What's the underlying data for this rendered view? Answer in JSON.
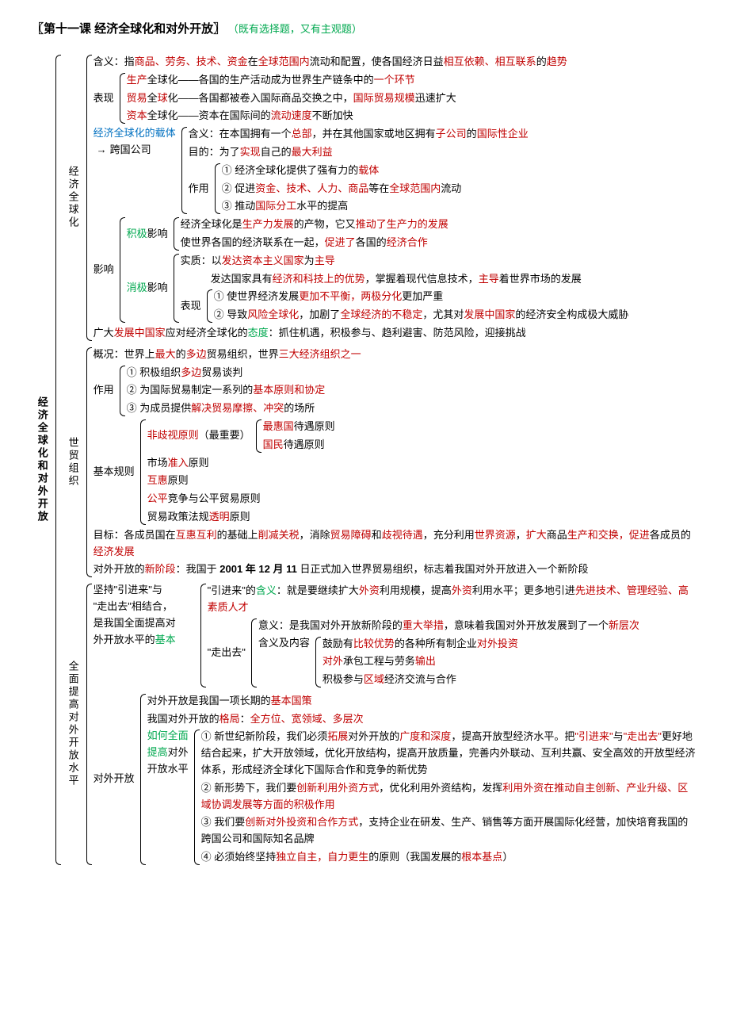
{
  "title": "〖第十一课 经济全球化和对外开放〗",
  "subtitle_open": "（",
  "subtitle_text": "既有选择题，又有主观题",
  "subtitle_close": "）",
  "root": "经济全球化和对外开放",
  "s1": {
    "label": "经济全球化",
    "l1a": "含义：指",
    "l1b": "商品、劳务、技术、资金",
    "l1c": "在",
    "l1d": "全球范围内",
    "l1e": "流动和配置，使各国经济日益",
    "l1f": "相互依赖、相互联系",
    "l1g": "的",
    "l1h": "趋势",
    "bx_label": "表现",
    "bx1a": "生产",
    "bx1b": "全球化——各国的生产活动成为世界生产链条中的",
    "bx1c": "一个环节",
    "bx2a": "贸易",
    "bx2b": "全",
    "bx2c": "球",
    "bx2d": "化——各国都被卷入国际商品交换之中，",
    "bx2e": "国际贸易规模",
    "bx2f": "迅速扩大",
    "bx3a": "资本",
    "bx3b": "全球化——资本在国际间的",
    "bx3c": "流动速度",
    "bx3d": "不断加快",
    "carrier_a": "经济全球化的载体",
    "carrier_arrow": "→",
    "carrier_b": "跨国公司",
    "c1a": "含义：在本国拥有一个",
    "c1b": "总部",
    "c1c": "，并在其他国家或地区拥有",
    "c1d": "子公司",
    "c1e": "的",
    "c1f": "国际性企业",
    "c2a": "目的：为了",
    "c2b": "实现",
    "c2c": "自己的",
    "c2d": "最大利益",
    "c_role": "作用",
    "cr1a": "① 经济全球化提供了强有力的",
    "cr1b": "载体",
    "cr2a": "② 促进",
    "cr2b": "资金、技术、人力、商品",
    "cr2c": "等在",
    "cr2d": "全球范围内",
    "cr2e": "流动",
    "cr3a": "③ 推动",
    "cr3b": "国际分工",
    "cr3c": "水平的提高",
    "inf_label": "影响",
    "pos_label": "积极",
    "pos_label2": "影响",
    "p1a": "经济全球化是",
    "p1b": "生产力发展",
    "p1c": "的产物，它又",
    "p1d": "推动了生产力的发展",
    "p2a": "使世界各国的经济联系在一起，",
    "p2b": "促进了",
    "p2c": "各国的",
    "p2d": "经济合作",
    "neg_label": "消极",
    "neg_label2": "影响",
    "n1a": "实质：以",
    "n1b": "发达资本主义国家",
    "n1c": "为",
    "n1d": "主导",
    "n2a": "发达国家具有",
    "n2b": "经济和科技上的优势",
    "n2c": "，掌握着现代信息技术，",
    "n2d": "主导",
    "n2e": "着世界市场的发展",
    "n_bx": "表现",
    "nb1a": "① 使世界经济发展",
    "nb1b": "更加不平衡，两极分化",
    "nb1c": "更加严重",
    "nb2a": "② 导致",
    "nb2b": "风险全球化",
    "nb2c": "，加剧了",
    "nb2d": "全球经济的不稳定",
    "nb2e": "，尤其对",
    "nb2f": "发展中国家",
    "nb2g": "的经济安全构成极大威胁",
    "att1": "广大",
    "att2": "发展中国家",
    "att3": "应对经济全球化的",
    "att4": "态度",
    "att5": "：抓住机遇，积极参与、趋利避害、防范风险，迎接挑战"
  },
  "s2": {
    "label": "世贸组织",
    "ov1": "概况：世界上",
    "ov2": "最大",
    "ov3": "的",
    "ov4": "多边",
    "ov5": "贸易组织，世界",
    "ov6": "三大经济组织之一",
    "role": "作用",
    "r1a": "① 积极组织",
    "r1b": "多边",
    "r1c": "贸易谈判",
    "r2a": "② 为国际贸易制定一系列的",
    "r2b": "基本原则和协定",
    "r3a": "③ 为成员提供",
    "r3b": "解决贸易摩擦、冲突",
    "r3c": "的场所",
    "rules": "基本规则",
    "ru1a": "非歧视原则",
    "ru1b": "（最重要）",
    "ru1c1": "最惠国",
    "ru1c2": "待遇原则",
    "ru1d1": "国民",
    "ru1d2": "待遇原则",
    "ru2a": "市场",
    "ru2b": "准入",
    "ru2c": "原则",
    "ru3a": "互惠",
    "ru3b": "原则",
    "ru4a": "公平",
    "ru4b": "竞争与公平贸易原则",
    "ru5a": "贸易政策法规",
    "ru5b": "透明",
    "ru5c": "原则",
    "goal1": "目标：各成员国在",
    "goal2": "互惠互利",
    "goal3": "的基础上",
    "goal4": "削减关税",
    "goal5": "，消除",
    "goal6": "贸易障碍",
    "goal7": "和",
    "goal8": "歧视待遇",
    "goal9": "，充分利用",
    "goal10": "世界资源",
    "goal11": "，",
    "goal12": "扩大",
    "goal13": "商品",
    "goal14": "生产和交换，促进",
    "goal15": "各成员的",
    "goal16": "经济发展",
    "new1": "对外开放的",
    "new2": "新阶段",
    "new3": "：我国于 ",
    "new4": "2001 年 12 月 11",
    "new5": " 日正式加入世界贸易组织，标志着我国对外开放进入一个新阶段"
  },
  "s3": {
    "label": "全面提高对外开放水平",
    "comb_l1": "坚持\"引进来\"与",
    "comb_l2": "\"走出去\"相结合，",
    "comb_l3": "是我国全面提高对",
    "comb_l4": "外开放水平的",
    "comb_l4b": "基本",
    "in1": "\"引进来\"的",
    "in2": "含义",
    "in3": "：就是要继续扩大",
    "in4": "外资",
    "in5": "利用规模，提高",
    "in6": "外资",
    "in7": "利用水平；更多地引进",
    "in8": "先进技术、管理经验、高素质人才",
    "out_label": "\"走出去\"",
    "om1": "意义：是我国对外开放新阶段的",
    "om2": "重大举措",
    "om3": "，意味着我国对外开放发展到了一个",
    "om4": "新层次",
    "oc_label": "含义及内容",
    "oc1a": "鼓励有",
    "oc1b": "比较优势",
    "oc1c": "的各种所有制企业",
    "oc1d": "对外投资",
    "oc2a": "对外",
    "oc2b": "承包工程与劳务",
    "oc2c": "输出",
    "oc3a": "积极参与",
    "oc3b": "区域",
    "oc3c": "经济交流与合作",
    "open_label": "对外开放",
    "op1a": "对外开放是我国一项长期的",
    "op1b": "基本国策",
    "op2a": "我国对外开放的",
    "op2b": "格局",
    "op2c": "：",
    "op2d": "全方位、宽领域、多层次",
    "how_l1": "如何全面",
    "how_l2": "提高",
    "how_l2b": "对外",
    "how_l3": "开放水平",
    "h1a": "① 新世纪新阶段，我们必须",
    "h1b": "拓展",
    "h1c": "对外开放的",
    "h1d": "广度和深度",
    "h1e": "，提高开放型经济水平。把",
    "h1f": "\"引进来\"",
    "h1g": "与",
    "h1h": "\"走出去\"",
    "h1i": "更好地结合起来，扩大开放领域，优化开放结构，提高开放质量，完善内外联动、互利共赢、安全高效的开放型经济体系，形成经济全球化下国际合作和竞争的新优势",
    "h2a": "② 新形势下，我们要",
    "h2b": "创新利用外资方式",
    "h2c": "，优化利用外资结构，发挥",
    "h2d2": "利用外资在推动自主创新、产业升级、区域协调发展等方面的积极作用",
    "h3a": "③ 我们要",
    "h3b": "创新对外投资和合作方式",
    "h3c": "，支持企业在研发、生产、销售等方面开展国际化经营，加快培育我国的跨国公司和国际知名品牌",
    "h4a": "④ 必须始终坚持",
    "h4b": "独立自主，自力更生",
    "h4c": "的原则（我国发展的",
    "h4d": "根本基点",
    "h4e": "）"
  }
}
